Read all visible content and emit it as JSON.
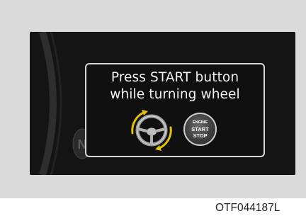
{
  "cluster_display": {
    "message_line_1": "Press START button",
    "message_line_2": "while turning wheel",
    "gear_indicator": "N",
    "engine_button": {
      "line_1": "ENGINE",
      "line_2": "START",
      "line_3": "STOP"
    },
    "icons": [
      "steering-wheel-icon",
      "rotation-arrows-icon",
      "engine-start-stop-button-icon"
    ],
    "colors": {
      "panel_background": "#141414",
      "message_border": "#d8d8d8",
      "arrow_accent": "#e8c200",
      "text": "#f2f2f2"
    }
  },
  "figure_code": "OTF044187L"
}
